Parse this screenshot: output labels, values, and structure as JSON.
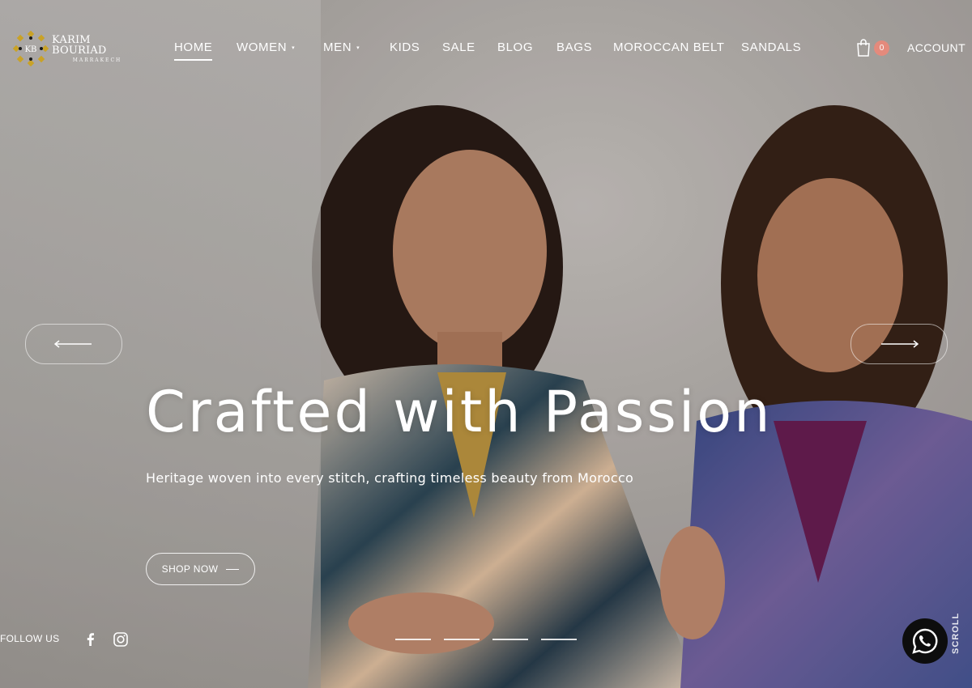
{
  "brand": {
    "monogram": "KB",
    "name": "KARIM BOURIAD",
    "city": "MARRAKECH"
  },
  "nav": {
    "items": [
      {
        "label": "HOME",
        "active": true,
        "has_dropdown": false
      },
      {
        "label": "WOMEN",
        "active": false,
        "has_dropdown": true
      },
      {
        "label": "MEN",
        "active": false,
        "has_dropdown": true
      },
      {
        "label": "KIDS",
        "active": false,
        "has_dropdown": false
      },
      {
        "label": "SALE",
        "active": false,
        "has_dropdown": false
      },
      {
        "label": "BLOG",
        "active": false,
        "has_dropdown": false
      },
      {
        "label": "BAGS",
        "active": false,
        "has_dropdown": false
      },
      {
        "label": "MOROCCAN BELT",
        "active": false,
        "has_dropdown": false
      },
      {
        "label": "SANDALS",
        "active": false,
        "has_dropdown": false
      }
    ],
    "dropdown_caret": "▾"
  },
  "header_actions": {
    "cart_count": "0",
    "account_label": "ACCOUNT"
  },
  "hero": {
    "title": "Crafted with Passion",
    "subtitle": "Heritage woven into every stitch, crafting timeless beauty from Morocco",
    "cta_label": "SHOP NOW",
    "slide_count": 4
  },
  "footer": {
    "follow_label": "FOLLOW US",
    "social_icons": [
      "facebook-icon",
      "instagram-icon"
    ],
    "scroll_label": "SCROLL"
  },
  "colors": {
    "accent_badge": "#e48a7c",
    "whatsapp_bg": "#0d0d0d",
    "logo_gold": "#c9a227"
  },
  "icons": {
    "cart": "shopping-bag-icon",
    "prev": "arrow-left-icon",
    "next": "arrow-right-icon",
    "chat": "whatsapp-icon"
  }
}
